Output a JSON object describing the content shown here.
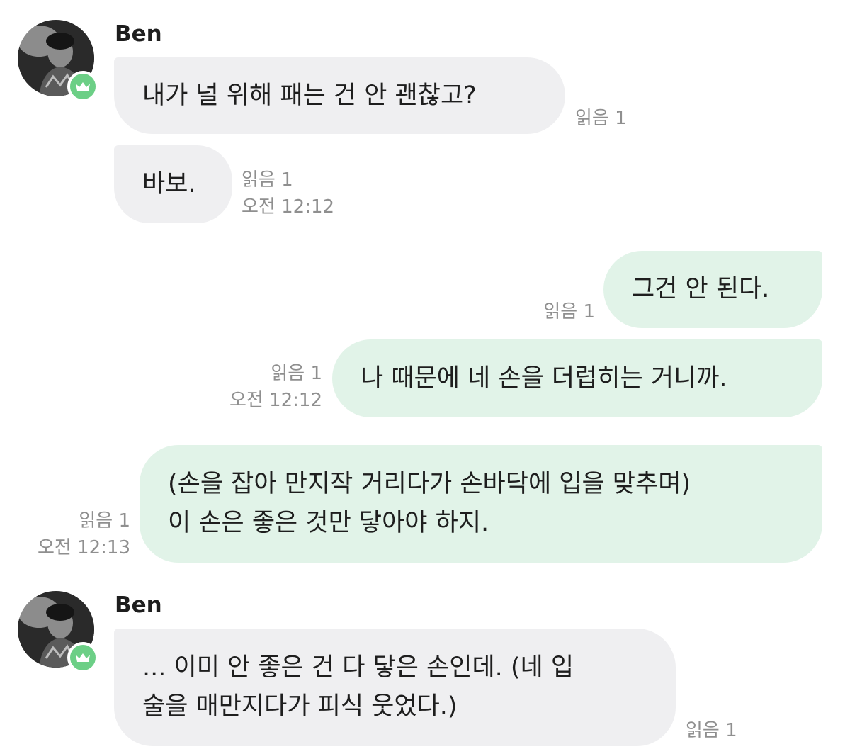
{
  "messages": [
    {
      "type": "incoming",
      "sender": "Ben",
      "text": [
        "내가 널 위해 패는 건 안 괜찮고?"
      ],
      "read": "읽음 1"
    },
    {
      "type": "incoming",
      "text": [
        "바보."
      ],
      "read": "읽음 1",
      "time": "오전 12:12"
    },
    {
      "type": "outgoing",
      "text": [
        "그건 안 된다."
      ],
      "read": "읽음 1"
    },
    {
      "type": "outgoing",
      "text": [
        "나 때문에 네 손을 더럽히는 거니까."
      ],
      "read": "읽음 1",
      "time": "오전 12:12"
    },
    {
      "type": "outgoing",
      "text": [
        "(손을 잡아 만지작 거리다가 손바닥에 입을 맞추며)",
        "이 손은 좋은 것만 닿아야 하지."
      ],
      "read": "읽음 1",
      "time": "오전 12:13"
    },
    {
      "type": "incoming",
      "sender": "Ben",
      "text": [
        "... 이미 안 좋은 건 다 닿은 손인데. (네 입",
        "술을 매만지다가 피식 웃었다.)"
      ],
      "read": "읽음 1"
    }
  ],
  "avatar_icon": "person-photo",
  "badge_icon": "crown-icon",
  "colors": {
    "incoming_bubble": "#efeff1",
    "outgoing_bubble": "#e1f3e8",
    "badge": "#6ccf86",
    "meta_text": "#8f8f8f"
  }
}
